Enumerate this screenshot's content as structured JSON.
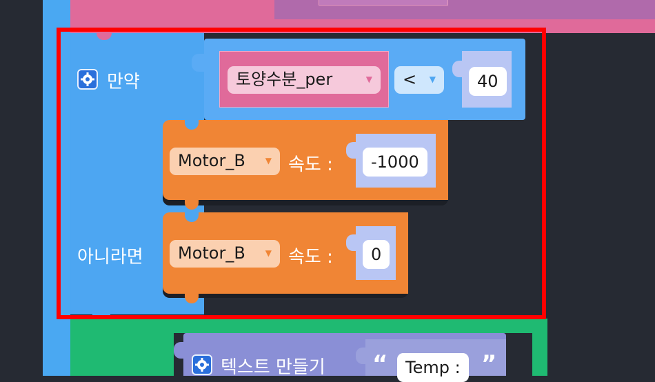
{
  "colors": {
    "workspace": "#262a33",
    "control_block": "#4da6f2",
    "operator_block": "#5aabf5",
    "variable_block": "#e06a9a",
    "motor_block": "#f08535",
    "text_block": "#8a8fd6",
    "value_socket": "#b9c6f4",
    "selection_box": "#ff0000",
    "green_block": "#1fba72"
  },
  "if_block": {
    "icon": "gear-icon",
    "if_label": "만약",
    "else_label": "아니라면",
    "condition": {
      "variable_value": "토양수분_per",
      "operator_value": "<",
      "compare_value": "40"
    }
  },
  "then_motor": {
    "motor_value": "Motor_B",
    "speed_label": "속도 :",
    "speed_value": "-1000"
  },
  "else_motor": {
    "motor_value": "Motor_B",
    "speed_label": "속도 :",
    "speed_value": "0"
  },
  "text_block": {
    "icon": "gear-icon",
    "label": "텍스트 만들기",
    "open_quote": "“",
    "value": "Temp :",
    "close_quote": "”"
  }
}
